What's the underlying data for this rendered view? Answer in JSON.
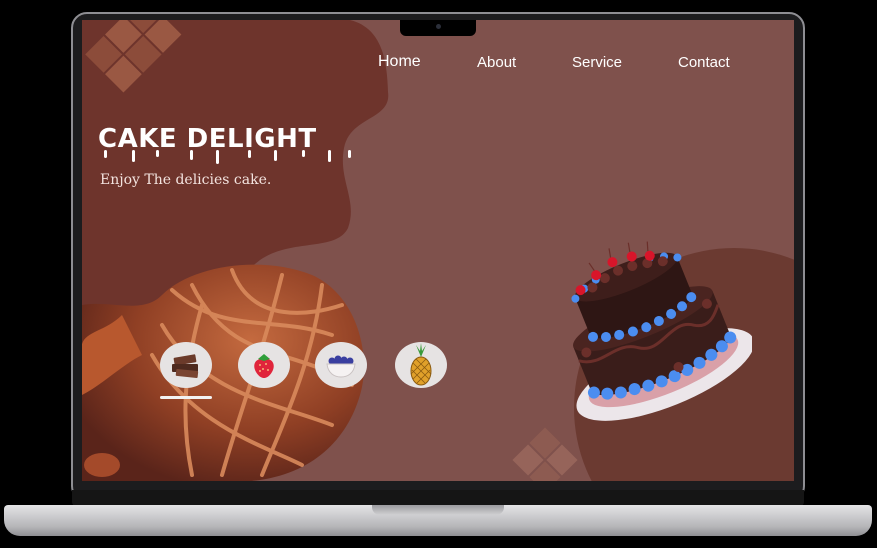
{
  "nav": {
    "home": "Home",
    "about": "About",
    "service": "Service",
    "contact": "Contact"
  },
  "hero": {
    "title": "CAKE DELIGHT",
    "subtitle": "Enjoy The delicies cake."
  },
  "thumbnails": [
    {
      "icon": "chocolate-icon",
      "selected": true
    },
    {
      "icon": "strawberry-icon",
      "selected": false
    },
    {
      "icon": "blueberry-bowl-icon",
      "selected": false
    },
    {
      "icon": "pineapple-icon",
      "selected": false
    }
  ],
  "colors": {
    "background": "#7f514c",
    "dark_blob": "#6b3a31",
    "text": "#ffffff",
    "frosting": "#4b8df0",
    "chocolate": "#3a1d1a"
  }
}
